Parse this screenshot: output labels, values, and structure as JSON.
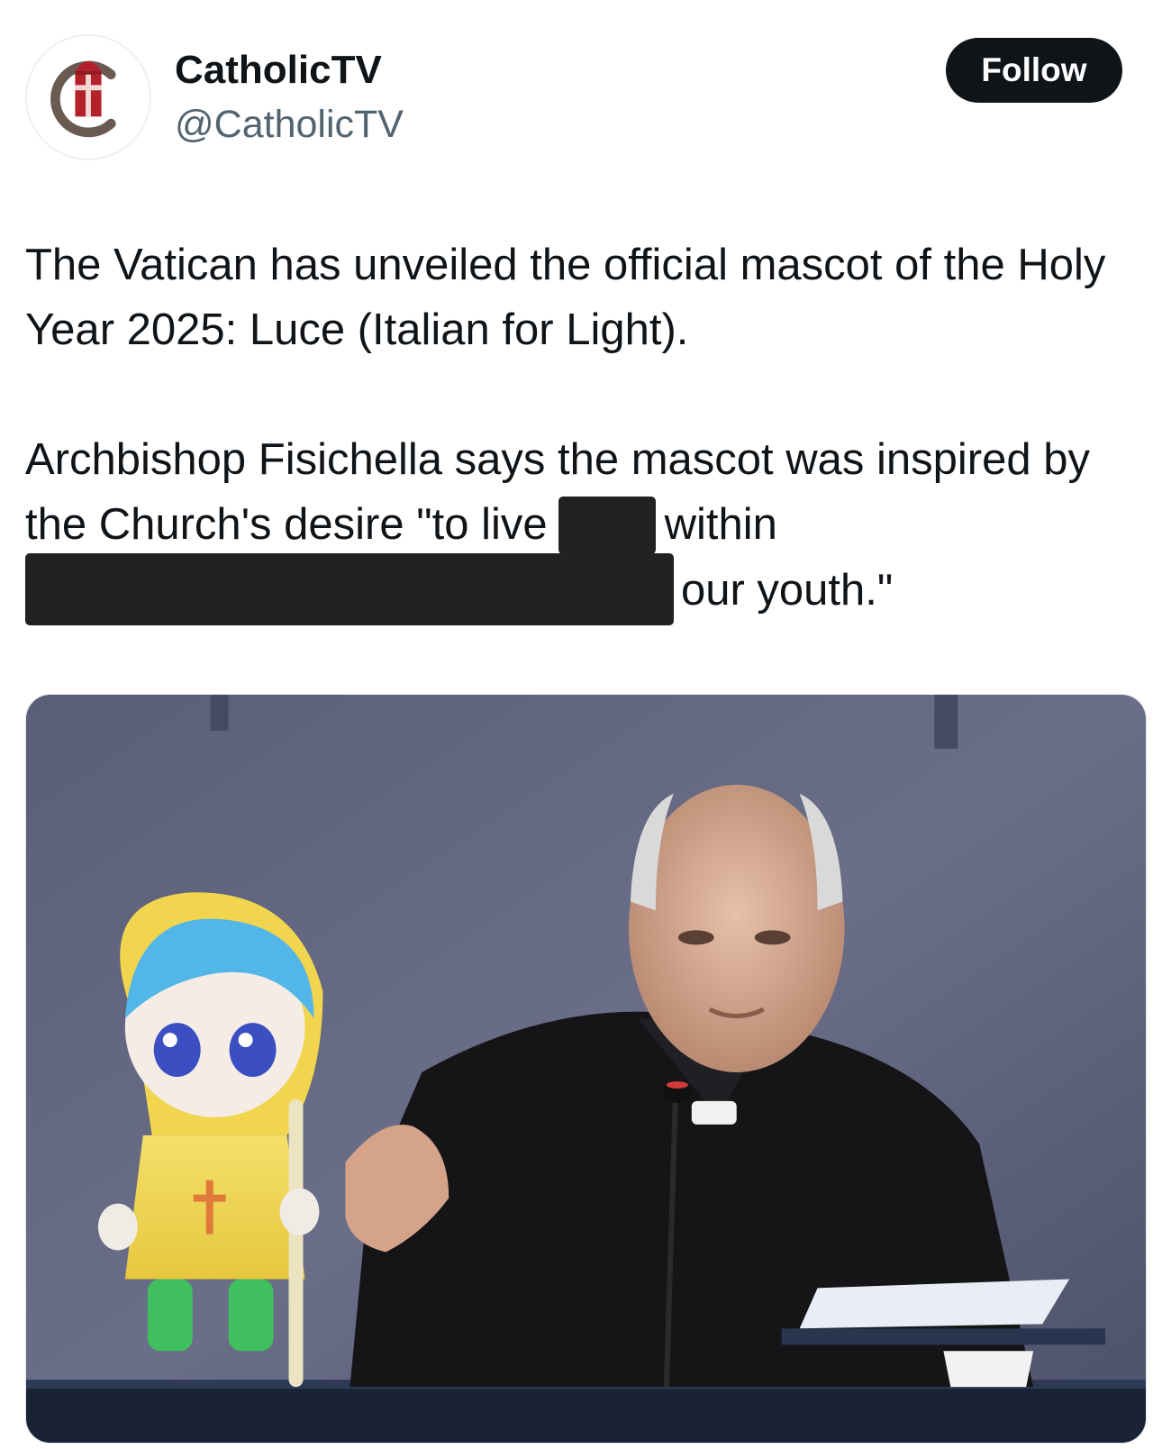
{
  "account": {
    "display_name": "CatholicTV",
    "handle": "@CatholicTV",
    "avatar_icon": "catholictv-logo-icon"
  },
  "actions": {
    "follow_label": "Follow"
  },
  "tweet": {
    "line_1": "The Vatican has unveiled the official mascot of the Holy Year 2025: Luce (Italian for Light).",
    "line_2_before": "Archbishop Fisichella says the mascot was inspired by the Church's desire \"to live",
    "line_2_after": "within",
    "line_2_end": "our youth.\""
  },
  "media": {
    "type": "photo",
    "redaction_color": "#222222"
  },
  "colors": {
    "follow_bg": "#0f1419",
    "handle": "#536471",
    "text": "#0f1419"
  }
}
